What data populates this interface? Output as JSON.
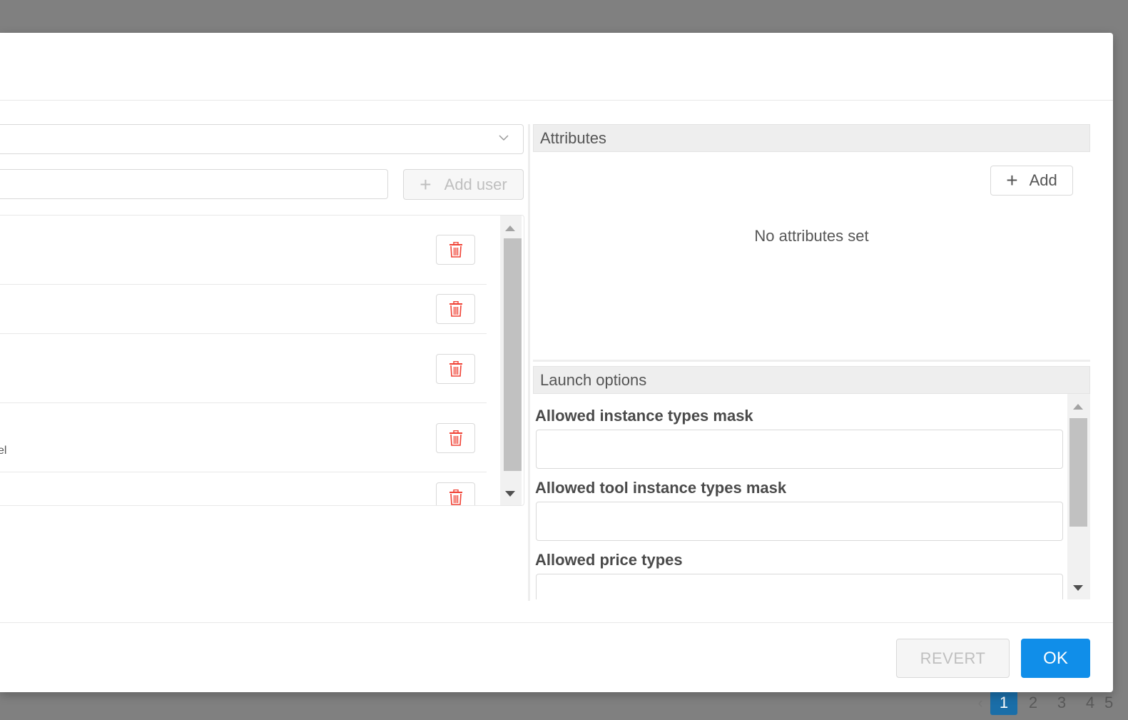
{
  "pagination": {
    "prev": "‹",
    "pages": [
      "1",
      "2",
      "3",
      "4",
      "5"
    ],
    "active": "1"
  },
  "left": {
    "select_value": "",
    "add_user_label": "Add user",
    "user_input_value": "",
    "rows": [
      {
        "text": ""
      },
      {
        "text": ""
      },
      {
        "text": ""
      },
      {
        "text": "el"
      },
      {
        "text": ""
      }
    ]
  },
  "attributes": {
    "title": "Attributes",
    "add_label": "Add",
    "empty_text": "No attributes set"
  },
  "launch_options": {
    "title": "Launch options",
    "fields": [
      {
        "label": "Allowed instance types mask",
        "value": ""
      },
      {
        "label": "Allowed tool instance types mask",
        "value": ""
      },
      {
        "label": "Allowed price types",
        "value": ""
      }
    ]
  },
  "footer": {
    "revert_label": "REVERT",
    "ok_label": "OK"
  },
  "colors": {
    "primary": "#108ee9",
    "danger": "#f04134",
    "overlay": "#808080"
  }
}
